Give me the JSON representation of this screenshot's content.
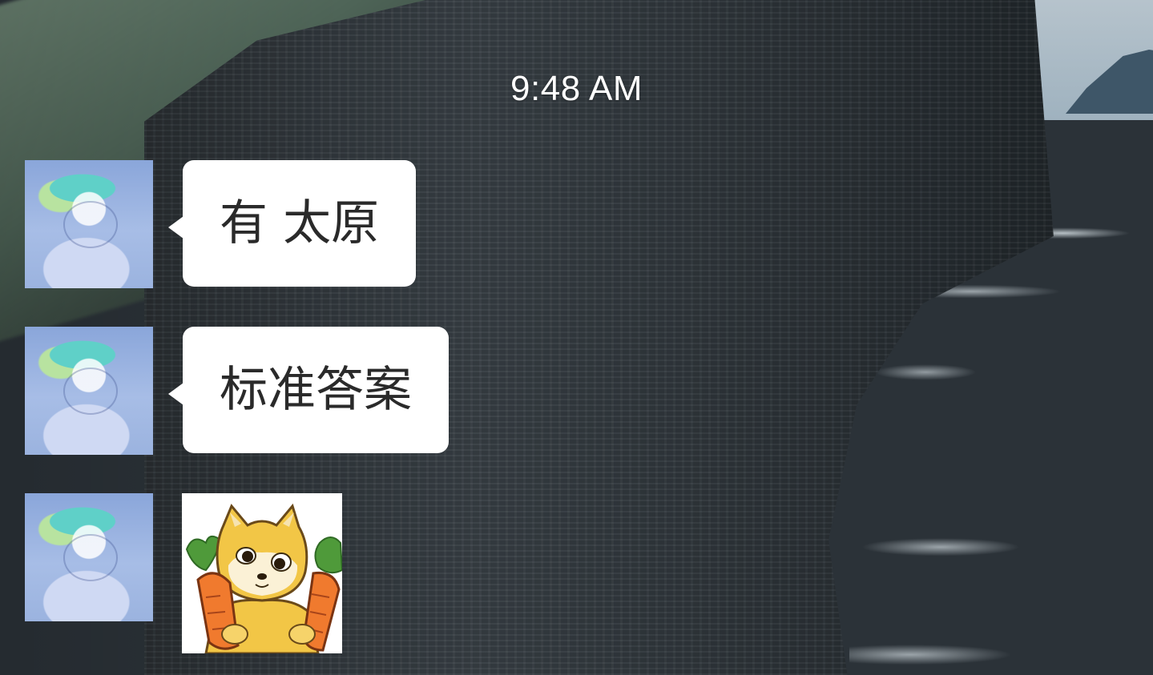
{
  "chat": {
    "timestamp": "9:48 AM",
    "messages": [
      {
        "sender_avatar": "anime-character-avatar",
        "type": "text",
        "text": "有 太原"
      },
      {
        "sender_avatar": "anime-character-avatar",
        "type": "text",
        "text": "标准答案"
      },
      {
        "sender_avatar": "anime-character-avatar",
        "type": "sticker",
        "sticker": "shiba-dog-holding-carrots"
      }
    ]
  },
  "colors": {
    "bubble_background": "#ffffff",
    "bubble_text": "#2a2a2a",
    "timestamp_text": "#ffffff"
  }
}
